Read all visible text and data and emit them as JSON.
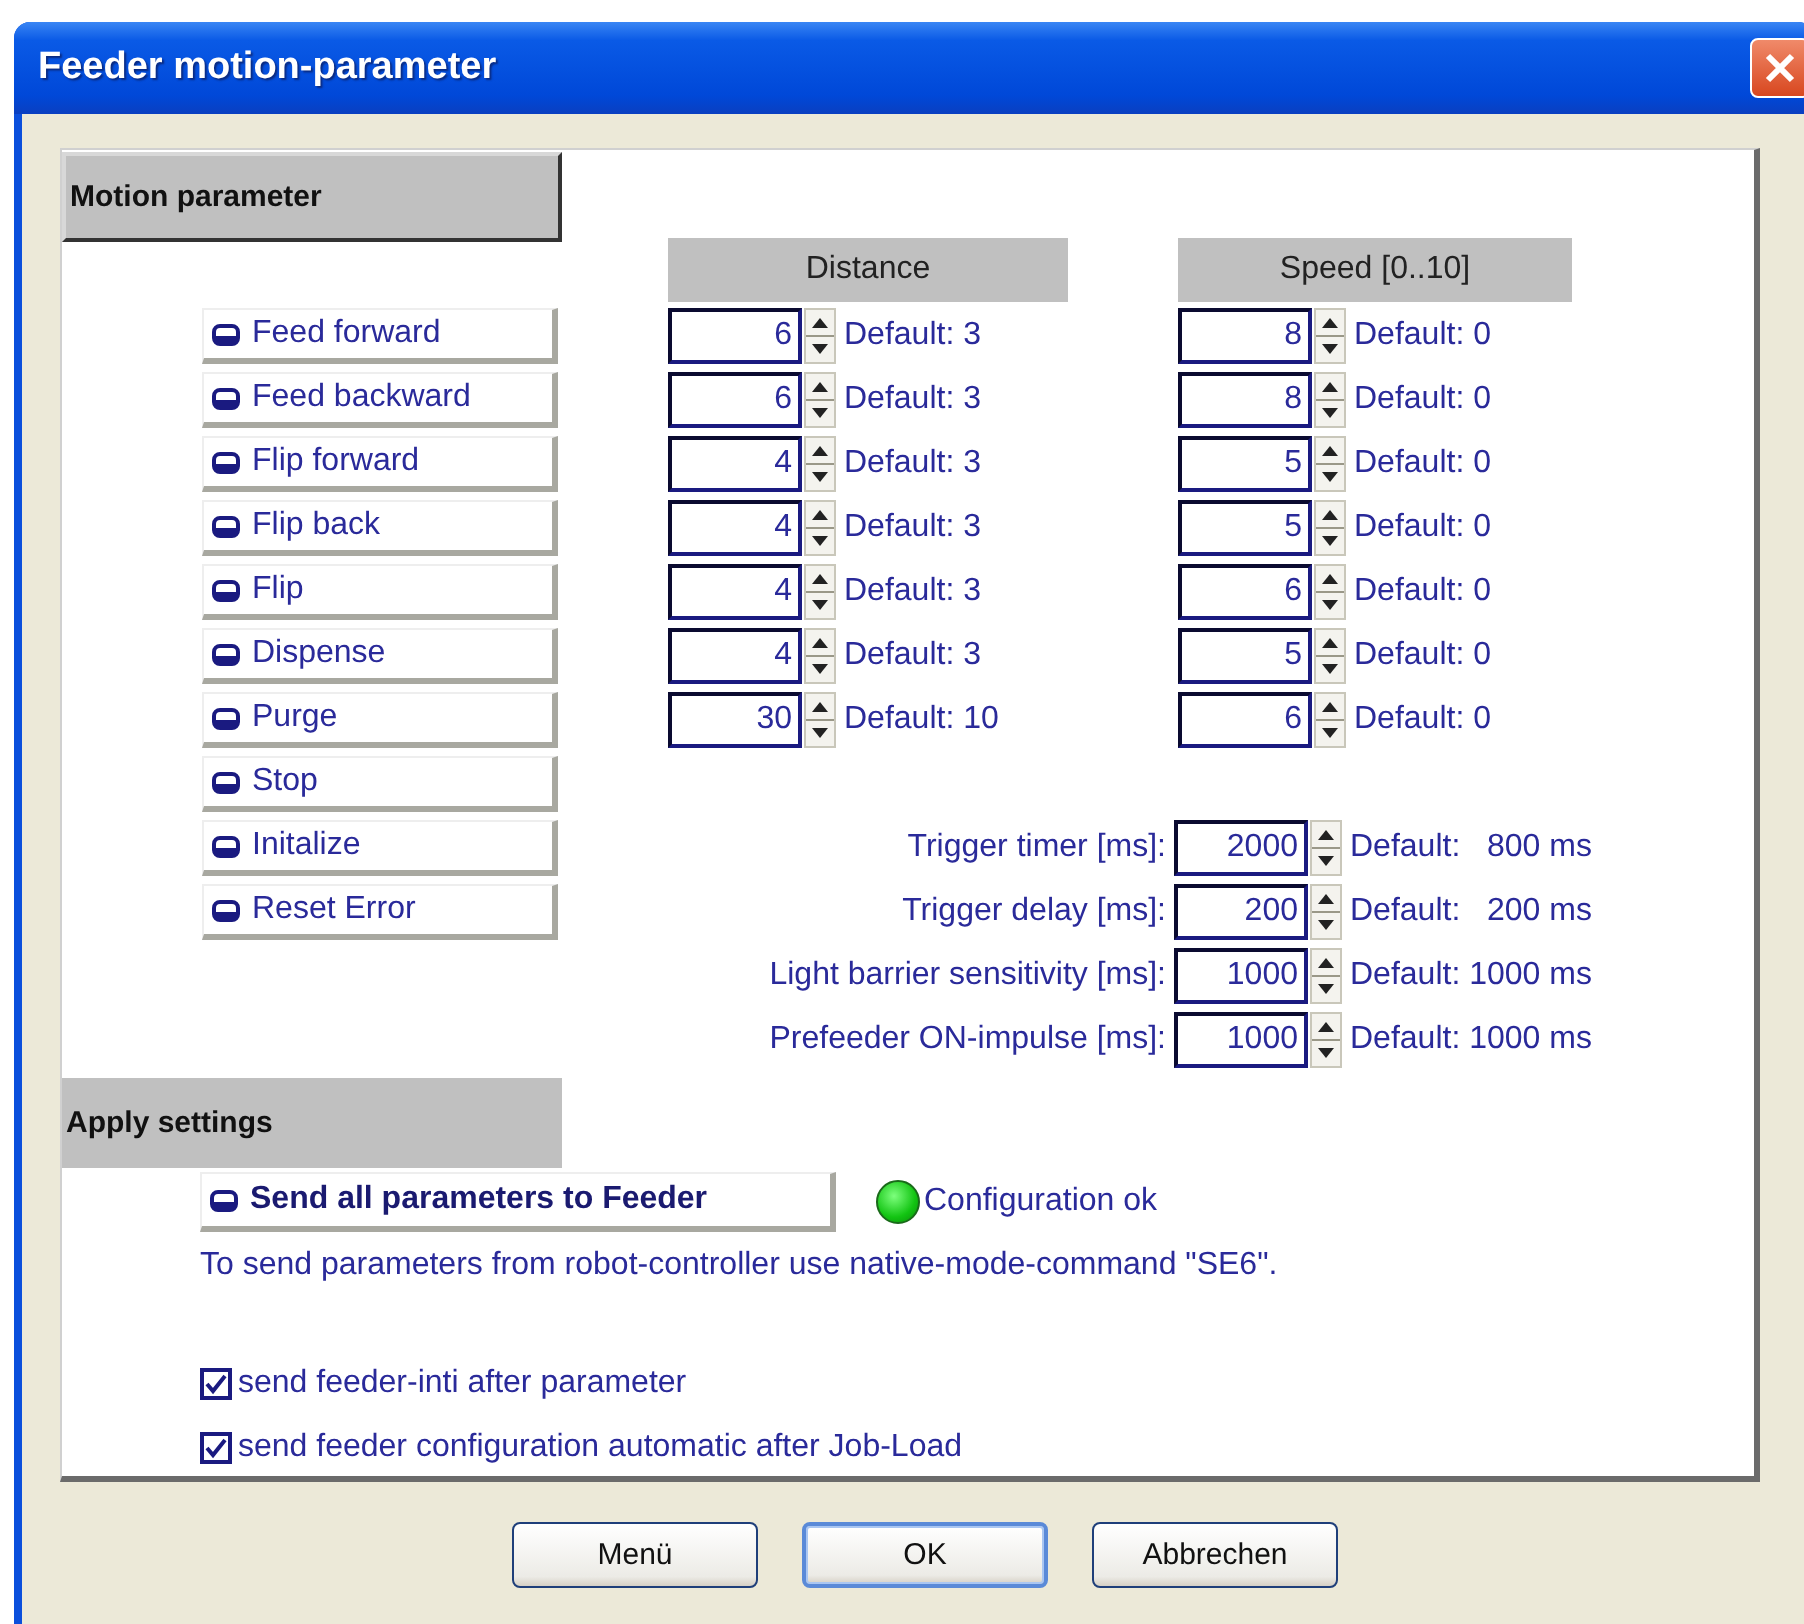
{
  "window": {
    "title": "Feeder motion-parameter"
  },
  "motion": {
    "heading": "Motion parameter",
    "actions": [
      "Feed forward",
      "Feed backward",
      "Flip forward",
      "Flip back",
      "Flip",
      "Dispense",
      "Purge",
      "Stop",
      "Initalize",
      "Reset Error"
    ],
    "columns": [
      "Distance",
      "Speed [0..10]"
    ],
    "rows": [
      {
        "distance": {
          "value": "6",
          "default": "Default: 3"
        },
        "speed": {
          "value": "8",
          "default": "Default: 0"
        }
      },
      {
        "distance": {
          "value": "6",
          "default": "Default: 3"
        },
        "speed": {
          "value": "8",
          "default": "Default: 0"
        }
      },
      {
        "distance": {
          "value": "4",
          "default": "Default: 3"
        },
        "speed": {
          "value": "5",
          "default": "Default: 0"
        }
      },
      {
        "distance": {
          "value": "4",
          "default": "Default: 3"
        },
        "speed": {
          "value": "5",
          "default": "Default: 0"
        }
      },
      {
        "distance": {
          "value": "4",
          "default": "Default: 3"
        },
        "speed": {
          "value": "6",
          "default": "Default: 0"
        }
      },
      {
        "distance": {
          "value": "4",
          "default": "Default: 3"
        },
        "speed": {
          "value": "5",
          "default": "Default: 0"
        }
      },
      {
        "distance": {
          "value": "30",
          "default": "Default: 10"
        },
        "speed": {
          "value": "6",
          "default": "Default: 0"
        }
      }
    ],
    "timings": [
      {
        "label": "Trigger timer [ms]:",
        "value": "2000",
        "default": "Default:   800 ms"
      },
      {
        "label": "Trigger delay [ms]:",
        "value": "200",
        "default": "Default:   200 ms"
      },
      {
        "label": "Light barrier sensitivity [ms]:",
        "value": "1000",
        "default": "Default: 1000 ms"
      },
      {
        "label": "Prefeeder ON-impulse [ms]:",
        "value": "1000",
        "default": "Default: 1000 ms"
      }
    ]
  },
  "apply": {
    "heading": "Apply settings",
    "send_button": "Send all parameters to Feeder",
    "status": {
      "text": "Configuration ok",
      "ok": true
    },
    "info": "To send parameters from robot-controller use native-mode-command \"SE6\".",
    "options": [
      {
        "label": "send feeder-inti after parameter",
        "checked": true
      },
      {
        "label": "send feeder configuration automatic after Job-Load",
        "checked": true
      }
    ]
  },
  "buttons": [
    {
      "label": "Menü",
      "default": false
    },
    {
      "label": "OK",
      "default": true
    },
    {
      "label": "Abbrechen",
      "default": false
    }
  ]
}
